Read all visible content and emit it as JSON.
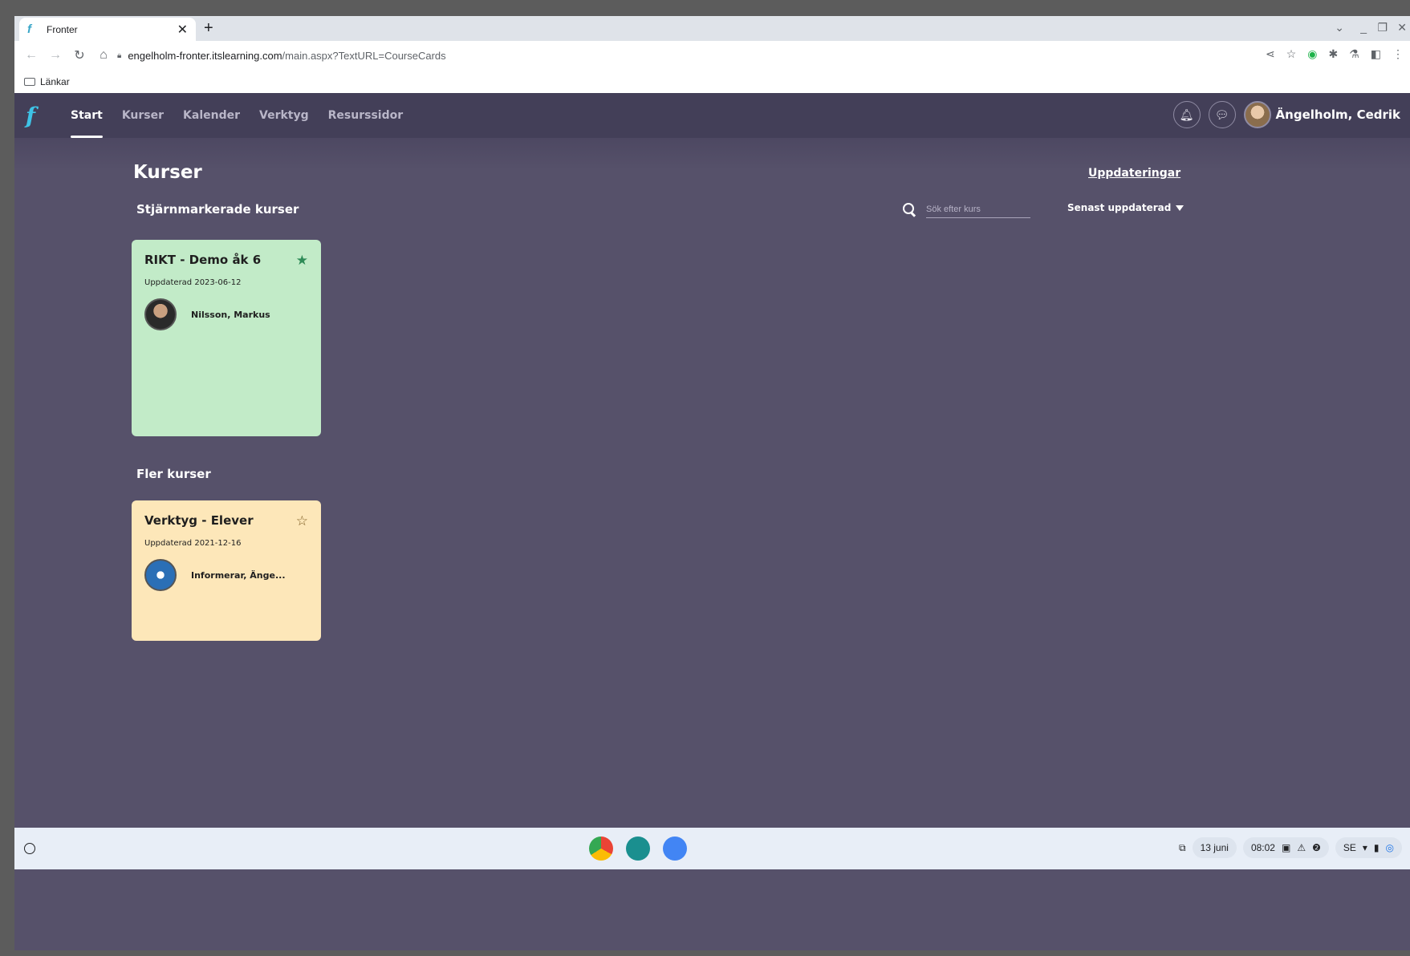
{
  "browser": {
    "tab_title": "Fronter",
    "url_host": "engelholm-fronter.itslearning.com",
    "url_path": "/main.aspx?TextURL=CourseCards",
    "bookmark_folder": "Länkar"
  },
  "nav": {
    "items": [
      {
        "label": "Start",
        "active": true
      },
      {
        "label": "Kurser"
      },
      {
        "label": "Kalender"
      },
      {
        "label": "Verktyg"
      },
      {
        "label": "Resurssidor"
      }
    ]
  },
  "user": {
    "name": "Ängelholm, Cedrik"
  },
  "page": {
    "title": "Kurser",
    "updates_link": "Uppdateringar",
    "starred_heading": "Stjärnmarkerade kurser",
    "more_heading": "Fler kurser",
    "search_placeholder": "Sök efter kurs",
    "sort_label": "Senast uppdaterad"
  },
  "courses": {
    "starred": [
      {
        "title": "RIKT - Demo åk 6",
        "updated": "Uppdaterad 2023-06-12",
        "owner": "Nilsson, Markus",
        "color": "#c2ebc8",
        "starred": true
      }
    ],
    "more": [
      {
        "title": "Verktyg - Elever",
        "updated": "Uppdaterad 2021-12-16",
        "owner": "Informerar, Änge...",
        "color": "#fde7b9",
        "starred": false
      }
    ]
  },
  "shelf": {
    "date": "13 juni",
    "time": "08:02",
    "locale": "SE"
  }
}
